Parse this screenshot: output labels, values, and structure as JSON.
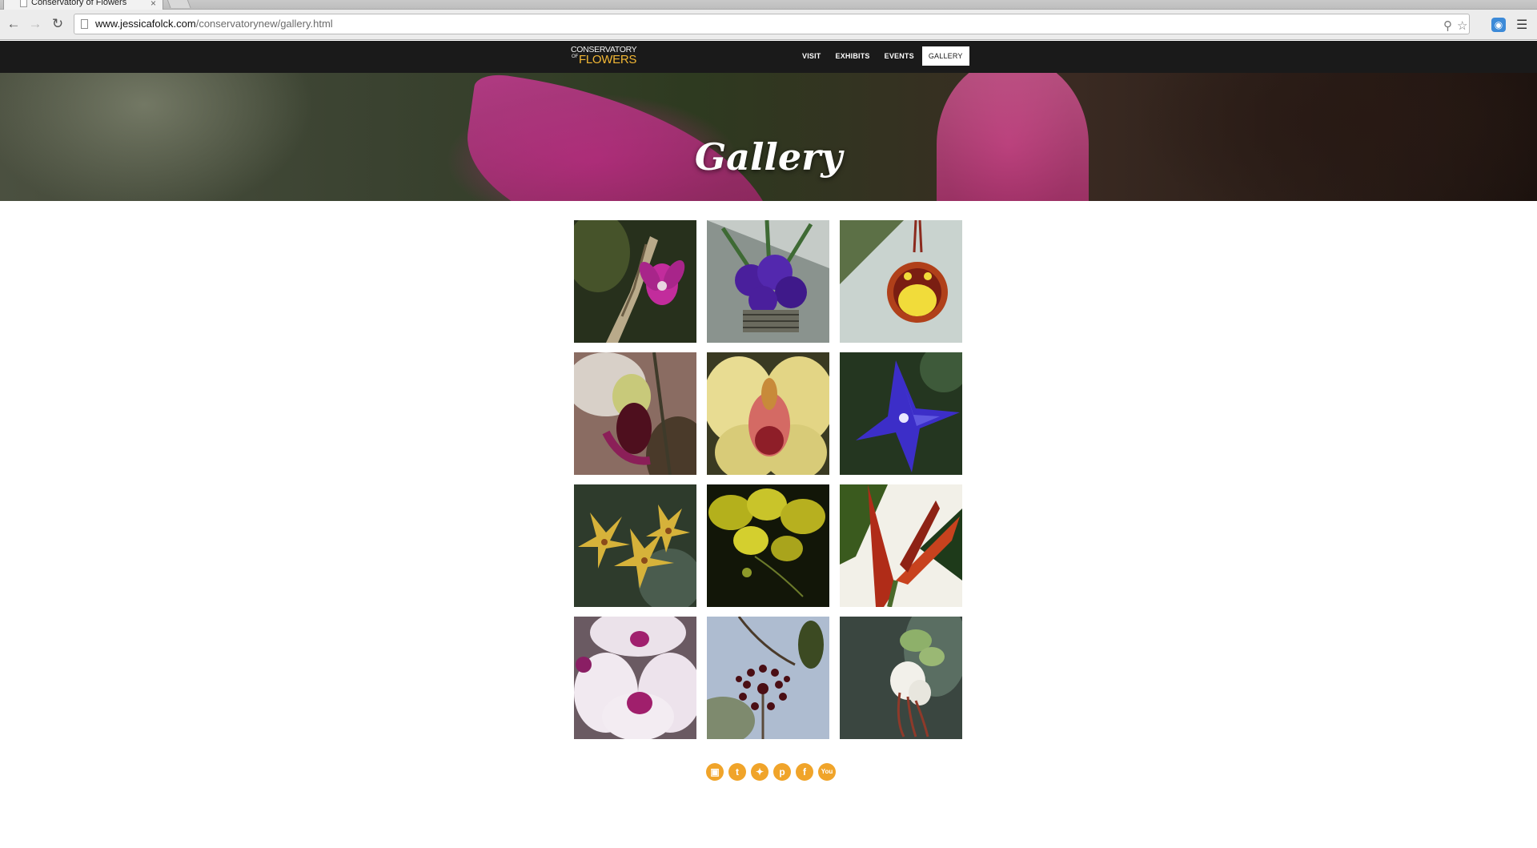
{
  "browser": {
    "tab_title": "Conservatory of Flowers",
    "tab_close": "×",
    "url_host": "www.jessicafolck.com",
    "url_path": "/conservatorynew/gallery.html"
  },
  "site": {
    "logo_top": "CONSERVATORY",
    "logo_of": "OF",
    "logo_bottom": "FLOWERS",
    "nav": [
      "VISIT",
      "EXHIBITS",
      "EVENTS",
      "GALLERY"
    ],
    "active_nav": "GALLERY",
    "accent_color": "#f0a42a"
  },
  "hero": {
    "title": "Gallery"
  },
  "gallery": {
    "items": [
      {
        "subject": "magenta orchid on branch"
      },
      {
        "subject": "purple orchids"
      },
      {
        "subject": "red and yellow oncidium"
      },
      {
        "subject": "slipper orchid"
      },
      {
        "subject": "yellow cymbidium"
      },
      {
        "subject": "blue star flower"
      },
      {
        "subject": "spotted yellow orchids"
      },
      {
        "subject": "yellow dancing orchids"
      },
      {
        "subject": "bird of paradise"
      },
      {
        "subject": "white and pink phalaenopsis"
      },
      {
        "subject": "dark red star cluster"
      },
      {
        "subject": "white hanging flowers"
      }
    ]
  },
  "social": [
    "instagram",
    "tumblr",
    "twitter",
    "pinterest",
    "facebook",
    "youtube"
  ]
}
